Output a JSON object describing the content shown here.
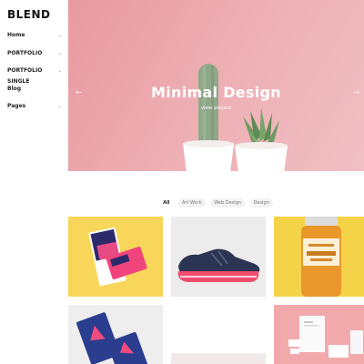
{
  "brand": {
    "logo": "BLEND"
  },
  "sidebar": {
    "items": [
      {
        "label": "Home",
        "has_submenu": true
      },
      {
        "label": "PORTFOLIO",
        "has_submenu": true
      },
      {
        "label": "PORTFOLIO SINGLE",
        "has_submenu": true
      },
      {
        "label": "Blog",
        "has_submenu": false
      },
      {
        "label": "Pages",
        "has_submenu": true
      }
    ]
  },
  "hero": {
    "title": "Minimal Design",
    "subtitle": "view project",
    "background": "#eca8ad"
  },
  "filters": {
    "items": [
      "All",
      "Art Work",
      "Web Design",
      "Design"
    ],
    "active": "All"
  },
  "portfolio": {
    "items": [
      {
        "name": "stationery-card",
        "background": "#f7d65a"
      },
      {
        "name": "pink-sneaker",
        "background": "#ececec"
      },
      {
        "name": "jar-mockup",
        "background": "#f5d349"
      },
      {
        "name": "business-cards",
        "background": "#eeeeee"
      },
      {
        "name": "blank-card",
        "background": "#f1e9e9"
      },
      {
        "name": "branding-mockup",
        "background": "#f2a9ac"
      }
    ]
  }
}
